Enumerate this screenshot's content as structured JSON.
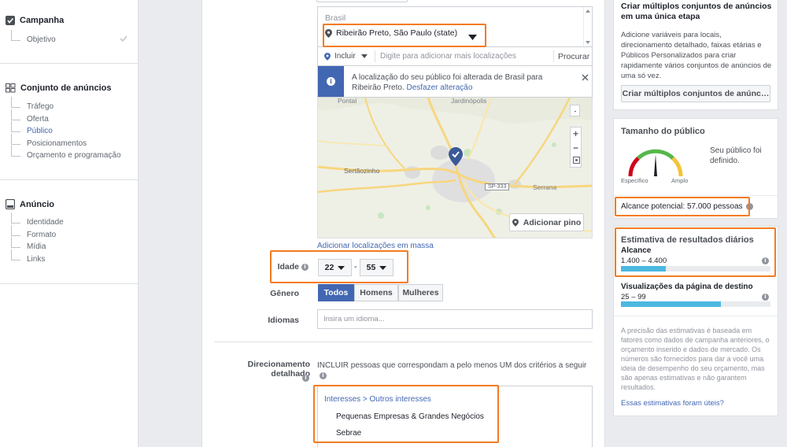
{
  "sidebar": {
    "campaign": {
      "title": "Campanha",
      "items": [
        {
          "label": "Objetivo"
        }
      ]
    },
    "adset": {
      "title": "Conjunto de anúncios",
      "items": [
        {
          "label": "Tráfego"
        },
        {
          "label": "Oferta"
        },
        {
          "label": "Público"
        },
        {
          "label": "Posicionamentos"
        },
        {
          "label": "Orçamento e programação"
        }
      ]
    },
    "ad": {
      "title": "Anúncio",
      "items": [
        {
          "label": "Identidade"
        },
        {
          "label": "Formato"
        },
        {
          "label": "Mídia"
        },
        {
          "label": "Links"
        }
      ]
    }
  },
  "location": {
    "country": "Brasil",
    "selected": "Ribeirão Preto, São Paulo (state)",
    "include_label": "Incluir",
    "search_placeholder": "Digite para adicionar mais localizações",
    "search_button": "Procurar",
    "notice_text": "A localização do seu público foi alterada de Brasil para Ribeirão Preto.",
    "notice_undo": "Desfazer alteração",
    "bulk_link": "Adicionar localizações em massa"
  },
  "map": {
    "places": {
      "top_left": "Pontal",
      "top_mid": "Jardinópolis",
      "left": "Sertãozinho",
      "right": "Serrana",
      "road": "SP-333"
    },
    "add_pin_label": "Adicionar pino",
    "zoom_in": "+",
    "zoom_out": "−"
  },
  "age": {
    "label": "Idade",
    "min": "22",
    "max": "55",
    "separator": "-"
  },
  "gender": {
    "label": "Gênero",
    "options": [
      "Todos",
      "Homens",
      "Mulheres"
    ],
    "selected": "Todos"
  },
  "languages": {
    "label": "Idiomas",
    "placeholder": "Insira um idioma..."
  },
  "detailed": {
    "label": "Direcionamento detalhado",
    "include_text": "INCLUIR pessoas que correspondam a pelo menos UM dos critérios a seguir",
    "breadcrumb": "Interesses > Outros interesses",
    "interests": [
      "Pequenas Empresas & Grandes Negócios",
      "Sebrae"
    ]
  },
  "multi_card": {
    "title": "Criar múltiplos conjuntos de anúncios em uma única etapa",
    "body": "Adicione variáveis para locais, direcionamento detalhado, faixas etárias e Públicos Personalizados para criar rapidamente vários conjuntos de anúncios de uma só vez.",
    "button": "Criar múltiplos conjuntos de anúnc…"
  },
  "audience": {
    "title": "Tamanho do público",
    "status": "Seu público foi definido.",
    "left_label": "Específico",
    "right_label": "Amplo",
    "needle_fraction": 0.5,
    "reach_text": "Alcance potencial: 57.000 pessoas"
  },
  "estimates": {
    "title": "Estimativa de resultados diários",
    "reach_label": "Alcance",
    "reach_range": "1.400 – 4.400",
    "reach_fill": 0.3,
    "views_label": "Visualizações da página de destino",
    "views_range": "25 – 99",
    "views_fill": 0.67,
    "disclaimer": "A precisão das estimativas é baseada em fatores como dados de campanha anteriores, o orçamento inserido e dados de mercado. Os números são fornecidos para dar a você uma ideia de desempenho do seu orçamento, mas são apenas estimativas e não garantem resultados.",
    "feedback_link": "Essas estimativas foram úteis?"
  },
  "colors": {
    "accent": "#4267b2",
    "highlight": "#f47b20",
    "bar": "#4cb8e0"
  }
}
